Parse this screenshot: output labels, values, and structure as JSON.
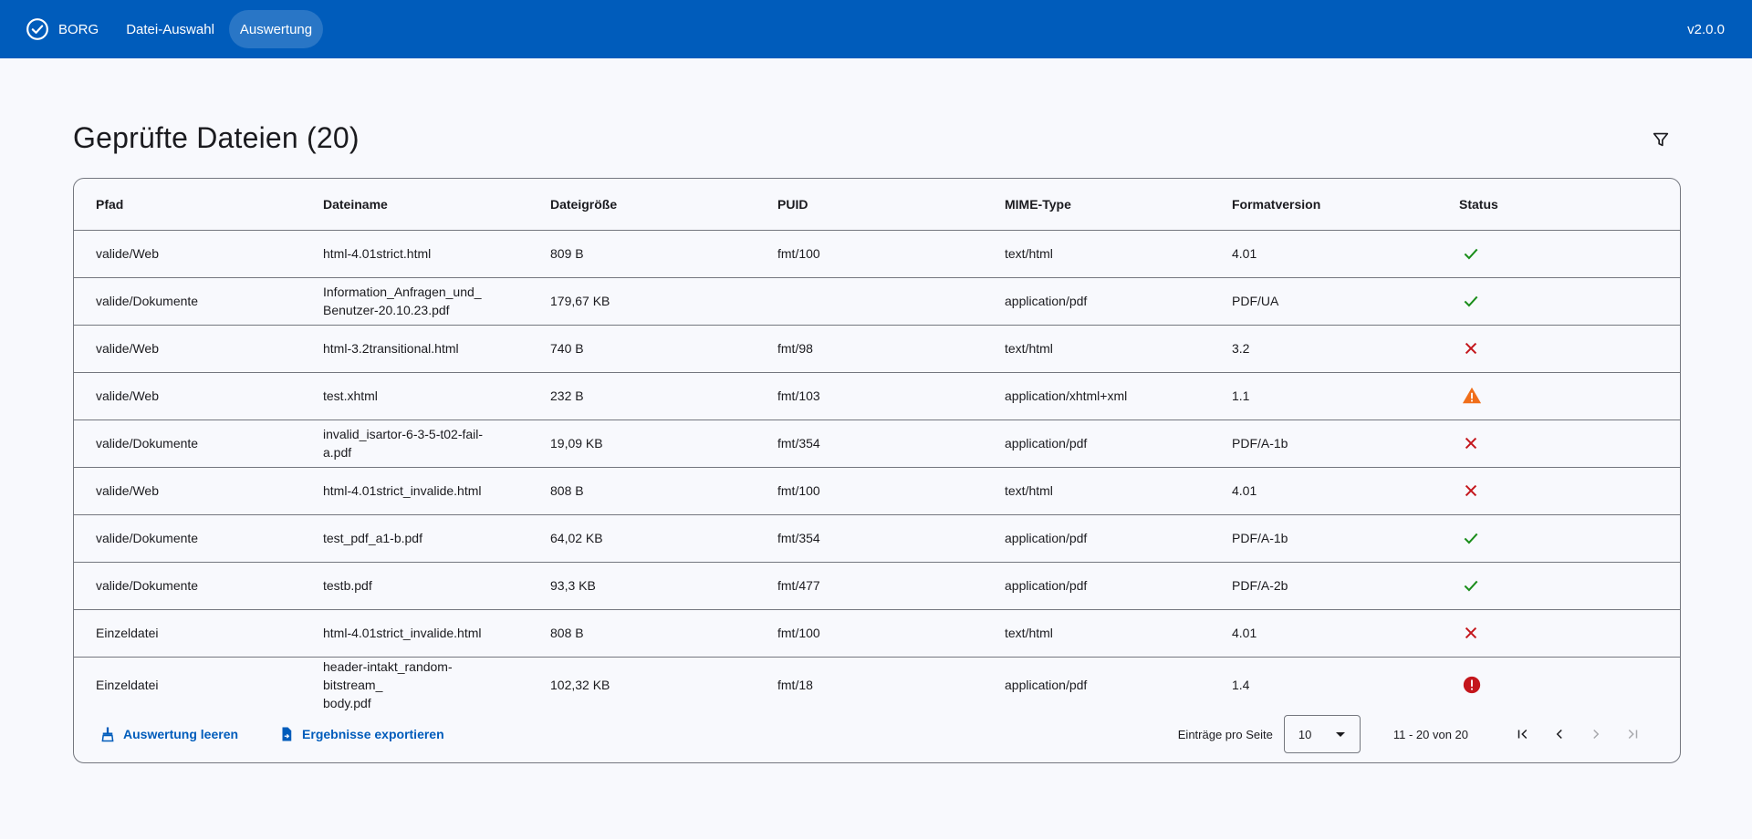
{
  "app": {
    "name": "BORG",
    "version": "v2.0.0",
    "nav": [
      {
        "label": "Datei-Auswahl",
        "active": false
      },
      {
        "label": "Auswertung",
        "active": true
      }
    ]
  },
  "page": {
    "title": "Geprüfte Dateien (20)",
    "filter_icon": "filter-icon"
  },
  "table": {
    "columns": [
      "Pfad",
      "Dateiname",
      "Dateigröße",
      "PUID",
      "MIME-Type",
      "Formatversion",
      "Status"
    ],
    "rows": [
      {
        "path": "valide/Web",
        "name": "html-4.01strict.html",
        "size": "809 B",
        "puid": "fmt/100",
        "mime": "text/html",
        "version": "4.01",
        "status": "valid"
      },
      {
        "path": "valide/Dokumente",
        "name": "Information_Anfragen_und_\nBenutzer-20.10.23.pdf",
        "size": "179,67 KB",
        "puid": "",
        "mime": "application/pdf",
        "version": "PDF/UA",
        "status": "valid"
      },
      {
        "path": "valide/Web",
        "name": "html-3.2transitional.html",
        "size": "740 B",
        "puid": "fmt/98",
        "mime": "text/html",
        "version": "3.2",
        "status": "invalid"
      },
      {
        "path": "valide/Web",
        "name": "test.xhtml",
        "size": "232 B",
        "puid": "fmt/103",
        "mime": "application/xhtml+xml",
        "version": "1.1",
        "status": "warning"
      },
      {
        "path": "valide/Dokumente",
        "name": "invalid_isartor-6-3-5-t02-fail-a.pdf",
        "size": "19,09 KB",
        "puid": "fmt/354",
        "mime": "application/pdf",
        "version": "PDF/A-1b",
        "status": "invalid"
      },
      {
        "path": "valide/Web",
        "name": "html-4.01strict_invalide.html",
        "size": "808 B",
        "puid": "fmt/100",
        "mime": "text/html",
        "version": "4.01",
        "status": "invalid"
      },
      {
        "path": "valide/Dokumente",
        "name": "test_pdf_a1-b.pdf",
        "size": "64,02 KB",
        "puid": "fmt/354",
        "mime": "application/pdf",
        "version": "PDF/A-1b",
        "status": "valid"
      },
      {
        "path": "valide/Dokumente",
        "name": "testb.pdf",
        "size": "93,3 KB",
        "puid": "fmt/477",
        "mime": "application/pdf",
        "version": "PDF/A-2b",
        "status": "valid"
      },
      {
        "path": "Einzeldatei",
        "name": "html-4.01strict_invalide.html",
        "size": "808 B",
        "puid": "fmt/100",
        "mime": "text/html",
        "version": "4.01",
        "status": "invalid"
      },
      {
        "path": "Einzeldatei",
        "name": "header-intakt_random-bitstream_\nbody.pdf",
        "size": "102,32 KB",
        "puid": "fmt/18",
        "mime": "application/pdf",
        "version": "1.4",
        "status": "error"
      }
    ]
  },
  "footer": {
    "clear_label": "Auswertung leeren",
    "export_label": "Ergebnisse exportieren",
    "per_page_label": "Einträge pro Seite",
    "per_page_value": "10",
    "range_label": "11 - 20 von 20"
  },
  "colors": {
    "primary": "#005cbb",
    "valid": "#1a8d1a",
    "invalid": "#c4161c",
    "warning": "#f06e1a",
    "error": "#c4161c"
  }
}
